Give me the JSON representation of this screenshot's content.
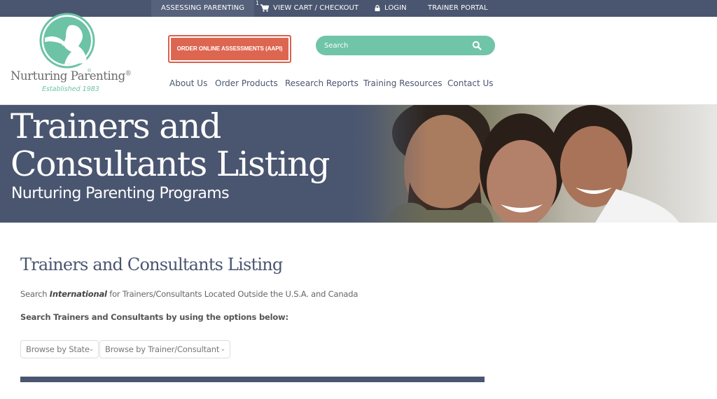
{
  "topbar": {
    "assessing_parenting": "ASSESSING PARENTING",
    "cart_count": "1",
    "view_cart": "VIEW CART / CHECKOUT",
    "login": "LOGIN",
    "trainer_portal": "TRAINER PORTAL"
  },
  "logo": {
    "name": "Nurturing Parenting",
    "registered": "®",
    "established": "Established 1983"
  },
  "header": {
    "order_button": "ORDER ONLINE ASSESSMENTS (AAPI)",
    "search_placeholder": "Search"
  },
  "nav": {
    "items": [
      {
        "label": "About Us"
      },
      {
        "label": "Order Products"
      },
      {
        "label": "Research Reports"
      },
      {
        "label": "Training Resources"
      },
      {
        "label": "Contact Us"
      }
    ]
  },
  "hero": {
    "title_line1": "Trainers and",
    "title_line2": "Consultants Listing",
    "subtitle": "Nurturing Parenting Programs"
  },
  "content": {
    "title": "Trainers and Consultants Listing",
    "intl_prefix": "Search ",
    "intl_link": "International",
    "intl_suffix": " for Trainers/Consultants Located Outside the U.S.A. and Canada",
    "instructions": "Search Trainers and Consultants by using the options below:",
    "select_state": "Browse by State",
    "select_trainer": "Browse by Trainer/Consultant"
  },
  "colors": {
    "navy": "#4a5670",
    "teal": "#70c4a7",
    "coral": "#dd6651"
  }
}
